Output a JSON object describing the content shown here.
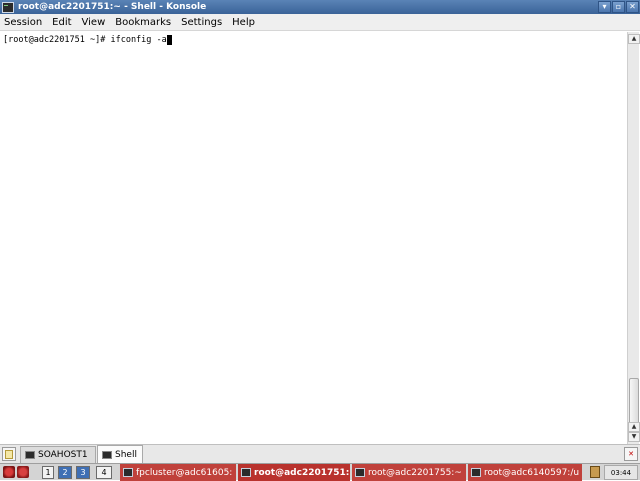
{
  "window": {
    "title": "root@adc2201751:~ - Shell - Konsole",
    "buttons": {
      "minimize": "▾",
      "maximize": "▫",
      "close": "✕"
    }
  },
  "menubar": {
    "items": [
      "Session",
      "Edit",
      "View",
      "Bookmarks",
      "Settings",
      "Help"
    ]
  },
  "terminal": {
    "prompt": "[root@adc2201751 ~]# ",
    "command": "ifconfig -a"
  },
  "tabs": [
    {
      "label": "SOAHOST1",
      "active": false
    },
    {
      "label": "Shell",
      "active": true
    }
  ],
  "taskbar": {
    "pager": [
      "1",
      "2",
      "3",
      "4"
    ],
    "tasks": [
      {
        "label": "fpcluster@adc61605:",
        "active": false
      },
      {
        "label": "root@adc2201751:",
        "active": true
      },
      {
        "label": "root@adc2201755:~",
        "active": false
      },
      {
        "label": "root@adc6140597:/u",
        "active": false
      }
    ],
    "clock": "03:44"
  },
  "icons": {
    "app": "terminal-icon",
    "new_tab": "new-session-icon",
    "close_tab": "close-session-icon",
    "kmenu": "k-menu-icon",
    "lock": "lock-screen-icon"
  }
}
